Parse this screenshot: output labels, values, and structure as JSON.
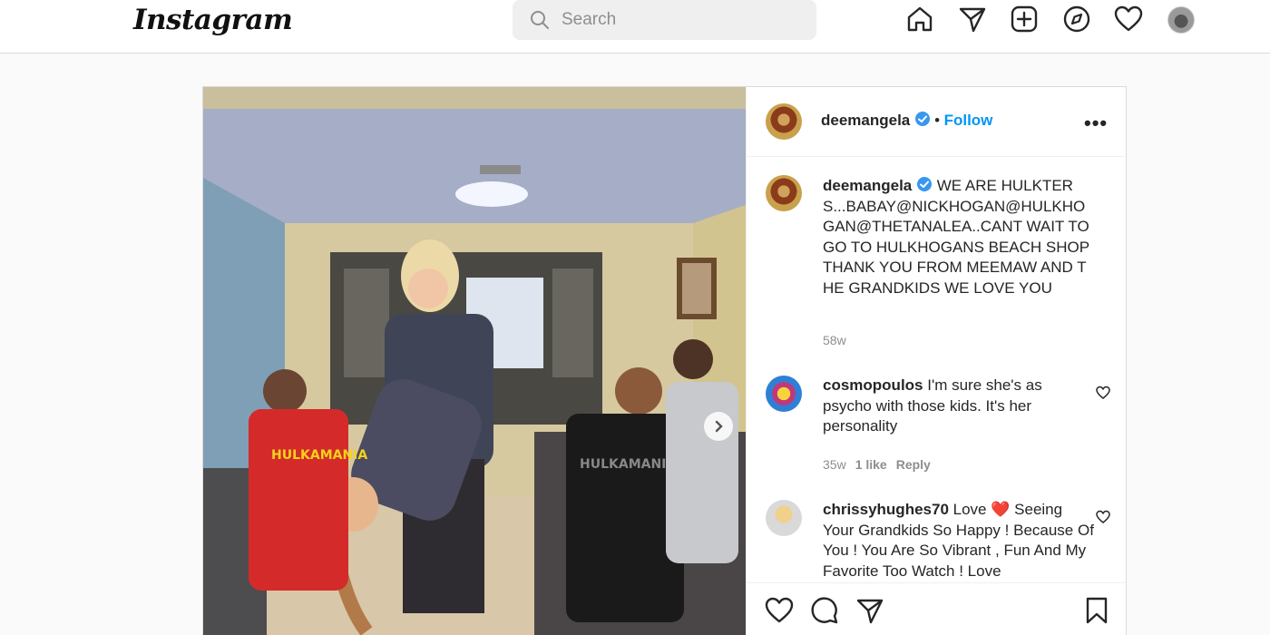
{
  "nav": {
    "logo": "Instagram",
    "search_placeholder": "Search",
    "icons": [
      "home-icon",
      "direct-icon",
      "new-post-icon",
      "explore-icon",
      "activity-icon",
      "profile-avatar"
    ]
  },
  "post": {
    "author": "deemangela",
    "verified": true,
    "follow_label": "Follow",
    "separator": "•",
    "more_label": "•••",
    "caption": "WE ARE HULKTERS...BABAY@NICKHOGAN@HULKHOGAN@THETANALEA..CANT WAIT TO GO TO HULKHOGANS BEACH SHOP\nTHANK YOU FROM MEEMAW AND THE GRANDKIDS WE LOVE YOU",
    "caption_age": "58w",
    "comments": [
      {
        "user": "cosmopoulos",
        "text": "I'm sure she's as psycho with those kids. It's her personality",
        "age": "35w",
        "likes": "1 like",
        "reply": "Reply"
      },
      {
        "user": "chrissyhughes70",
        "text_before": "Love",
        "emoji": "❤️",
        "text_after": "Seeing Your Grandkids So Happy ! Because Of You ! You Are So Vibrant , Fun And My Favorite Too Watch ! Love"
      }
    ]
  },
  "colors": {
    "accent": "#0095f6",
    "verified": "#3897f0",
    "muted": "#8e8e8e",
    "border": "#dbdbdb"
  }
}
